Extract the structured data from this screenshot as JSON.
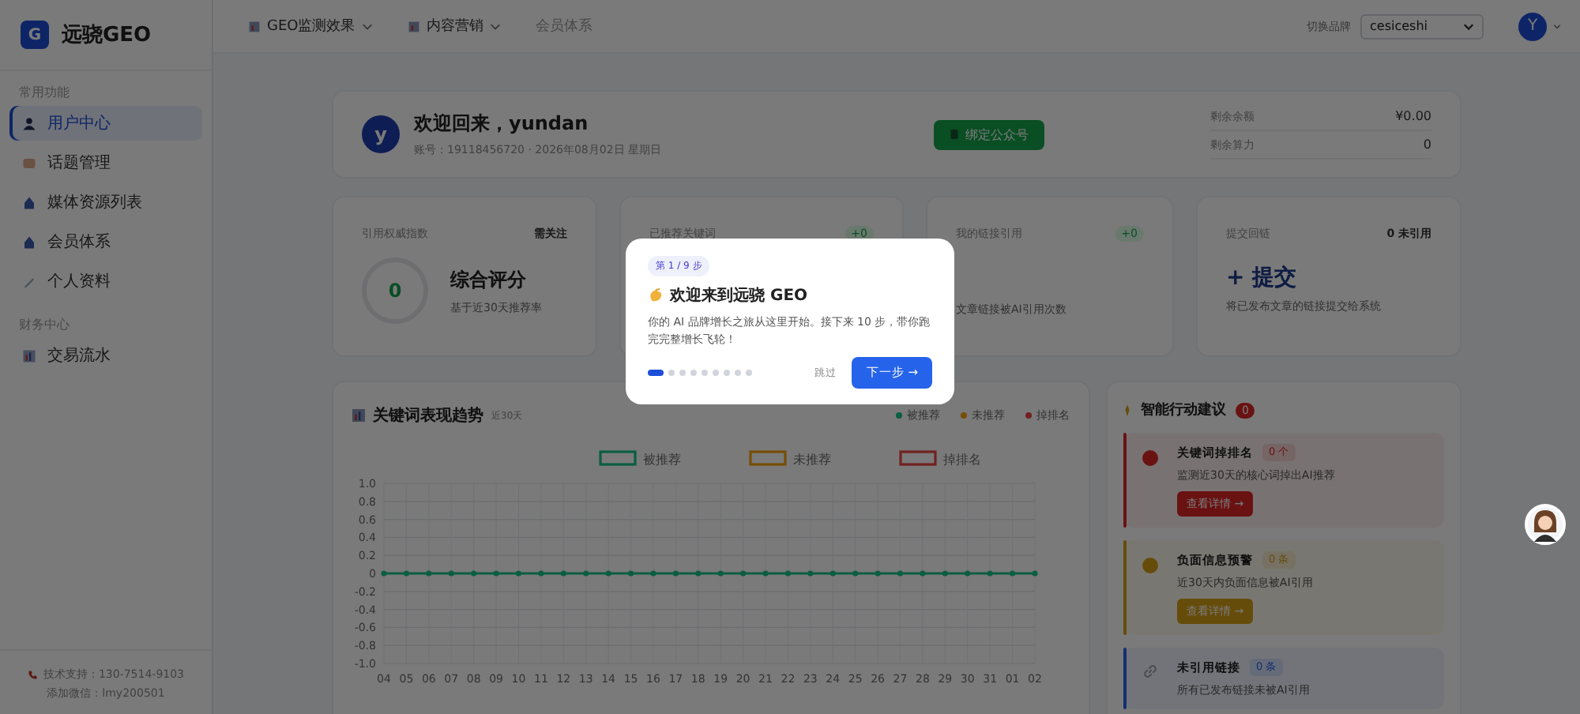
{
  "sidebar": {
    "logo_letter": "G",
    "brand": "远骁GEO",
    "sections": [
      {
        "title": "常用功能",
        "items": [
          {
            "label": "用户中心",
            "selected": true
          },
          {
            "label": "话题管理",
            "selected": false
          },
          {
            "label": "媒体资源列表",
            "selected": false
          },
          {
            "label": "会员体系",
            "selected": false
          },
          {
            "label": "个人资料",
            "selected": false
          }
        ]
      },
      {
        "title": "财务中心",
        "items": [
          {
            "label": "交易流水",
            "selected": false
          }
        ]
      }
    ],
    "footer": [
      "技术支持：130-7514-9103",
      "添加微信：lmy200501"
    ]
  },
  "top_nav": {
    "items": [
      {
        "label": "GEO监测效果",
        "has_menu": true
      },
      {
        "label": "内容营销",
        "has_menu": true
      },
      {
        "label": "会员体系",
        "has_menu": false
      }
    ],
    "brand_switch_label": "切换品牌",
    "brand_value": "cesiceshi",
    "avatar_letter": "Y"
  },
  "welcome": {
    "avatar_letter": "y",
    "title": "欢迎回来，yundan",
    "subtitle": "账号：19118456720 · 2026年08月02日 星期日",
    "bind_button": "绑定公众号",
    "balances": [
      {
        "label": "剩余余额",
        "value": "¥0.00"
      },
      {
        "label": "剩余算力",
        "value": "0"
      }
    ]
  },
  "stat_cards": [
    {
      "kind": "score",
      "label": "引用权威指数",
      "tag": "需关注",
      "score": "0",
      "title": "综合评分",
      "note": "基于近30天推荐率"
    },
    {
      "kind": "metric",
      "label": "已推荐关键词",
      "delta": "+0"
    },
    {
      "kind": "metric",
      "label": "我的链接引用",
      "delta": "+0",
      "note": "文章链接被AI引用次数"
    },
    {
      "kind": "submit",
      "label": "提交回链",
      "tag": "0 未引用",
      "action": "+ 提交",
      "note": "将已发布文章的链接提交给系统"
    }
  ],
  "trend": {
    "title": "关键词表现趋势",
    "period": "近30天",
    "legend": [
      {
        "label": "被推荐"
      },
      {
        "label": "未推荐"
      },
      {
        "label": "掉排名"
      }
    ],
    "chart_data": {
      "type": "line",
      "categories": [
        "04",
        "05",
        "06",
        "07",
        "08",
        "09",
        "10",
        "11",
        "12",
        "13",
        "14",
        "15",
        "16",
        "17",
        "18",
        "19",
        "20",
        "21",
        "22",
        "23",
        "24",
        "25",
        "26",
        "27",
        "28",
        "29",
        "30",
        "31",
        "01",
        "02"
      ],
      "series": [
        {
          "name": "被推荐",
          "color": "#0b5e41",
          "marker": "circle",
          "values": [
            0,
            0,
            0,
            0,
            0,
            0,
            0,
            0,
            0,
            0,
            0,
            0,
            0,
            0,
            0,
            0,
            0,
            0,
            0,
            0,
            0,
            0,
            0,
            0,
            0,
            0,
            0,
            0,
            0,
            0
          ]
        },
        {
          "name": "未推荐",
          "color": "#764d06",
          "values": [
            null,
            null,
            null,
            null,
            null,
            null,
            null,
            null,
            null,
            null,
            null,
            null,
            null,
            null,
            null,
            null,
            null,
            null,
            null,
            null,
            null,
            null,
            null,
            null,
            null,
            null,
            null,
            null,
            null,
            null
          ]
        },
        {
          "name": "掉排名",
          "color": "#722121",
          "values": [
            null,
            null,
            null,
            null,
            null,
            null,
            null,
            null,
            null,
            null,
            null,
            null,
            null,
            null,
            null,
            null,
            null,
            null,
            null,
            null,
            null,
            null,
            null,
            null,
            null,
            null,
            null,
            null,
            null,
            null
          ]
        }
      ],
      "grid": true,
      "legend": true,
      "ylim": [
        -1,
        1
      ],
      "yticks": [
        {
          "value": -1,
          "label": "-1.0"
        },
        -0.8,
        -0.6,
        -0.4,
        -0.2,
        0,
        0.2,
        0.4,
        0.6,
        0.8,
        {
          "value": 1,
          "label": "1.0"
        }
      ]
    }
  },
  "actions": {
    "title": "智能行动建议",
    "count": "0",
    "items": [
      {
        "kind": "alert",
        "title": "关键词掉排名",
        "count": "0 个",
        "desc": "监测近30天的核心词掉出AI推荐",
        "button": "查看详情 →",
        "color": "#6a1212"
      },
      {
        "kind": "alert",
        "title": "负面信息预警",
        "count": "0 条",
        "desc": "近30天内负面信息被AI引用",
        "button": "查看详情 →",
        "color": "#664d0b"
      },
      {
        "kind": "link",
        "title": "未引用链接",
        "count": "0 条",
        "desc": "所有已发布链接未被AI引用",
        "color": "#123071"
      }
    ]
  },
  "tour": {
    "step": "第 1 / 9 步",
    "title": "欢迎来到远骁 GEO",
    "body": "你的 AI 品牌增长之旅从这里开始。接下来 10 步，带你跑完完整增长飞轮！",
    "dots": [
      {
        "selected": true
      },
      {
        "selected": false
      },
      {
        "selected": false
      },
      {
        "selected": false
      },
      {
        "selected": false
      },
      {
        "selected": false
      },
      {
        "selected": false
      },
      {
        "selected": false
      },
      {
        "selected": false
      }
    ],
    "skip": "跳过",
    "next": "下一步 →"
  }
}
